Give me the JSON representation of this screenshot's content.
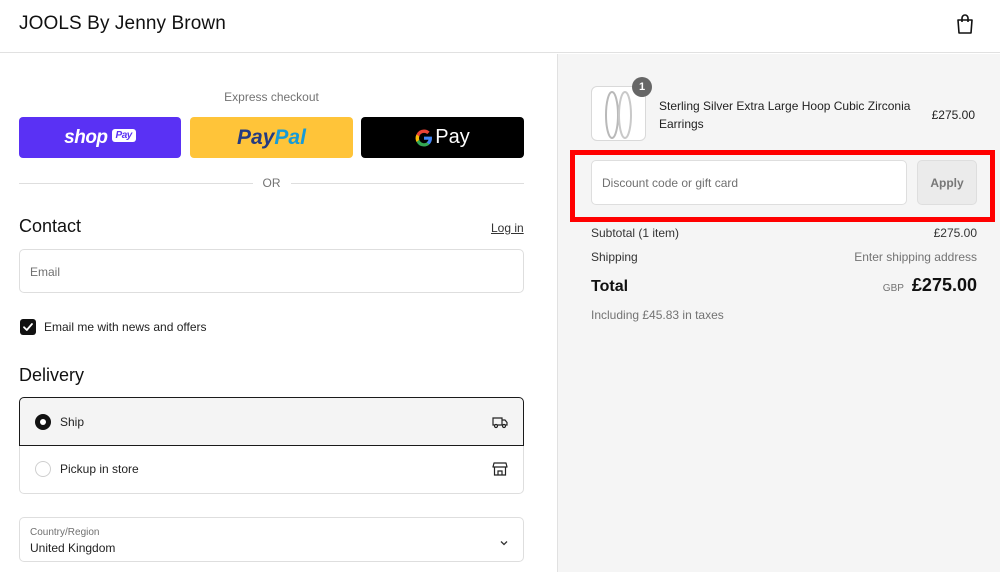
{
  "header": {
    "brand": "JOOLS By Jenny Brown",
    "cart_icon": "shopping-bag-icon"
  },
  "express": {
    "label": "Express checkout",
    "shop_pay": {
      "logo": "shop",
      "badge": "Pay",
      "color": "#5a31f4"
    },
    "paypal": {
      "part1": "Pay",
      "part2": "Pal",
      "color": "#ffc439"
    },
    "gpay": {
      "g": "G",
      "text": "Pay",
      "color": "#000000"
    },
    "divider": "OR"
  },
  "contact": {
    "title": "Contact",
    "login_link": "Log in",
    "email_placeholder": "Email",
    "newsletter_label": "Email me with news and offers",
    "newsletter_checked": true
  },
  "delivery": {
    "title": "Delivery",
    "options": [
      {
        "label": "Ship",
        "selected": true,
        "icon": "truck-icon"
      },
      {
        "label": "Pickup in store",
        "selected": false,
        "icon": "store-icon"
      }
    ],
    "country_label": "Country/Region",
    "country_value": "United Kingdom"
  },
  "summary": {
    "product": {
      "name": "Sterling Silver Extra Large Hoop Cubic Zirconia Earrings",
      "price": "£275.00",
      "quantity": "1"
    },
    "discount_placeholder": "Discount code or gift card",
    "apply_label": "Apply",
    "subtotal_label": "Subtotal (1 item)",
    "subtotal_value": "£275.00",
    "shipping_label": "Shipping",
    "shipping_value": "Enter shipping address",
    "total_label": "Total",
    "currency": "GBP",
    "total_value": "£275.00",
    "taxes": "Including £45.83 in taxes"
  },
  "colors": {
    "highlight": "#ff0000",
    "summary_bg": "#f5f5f5"
  }
}
